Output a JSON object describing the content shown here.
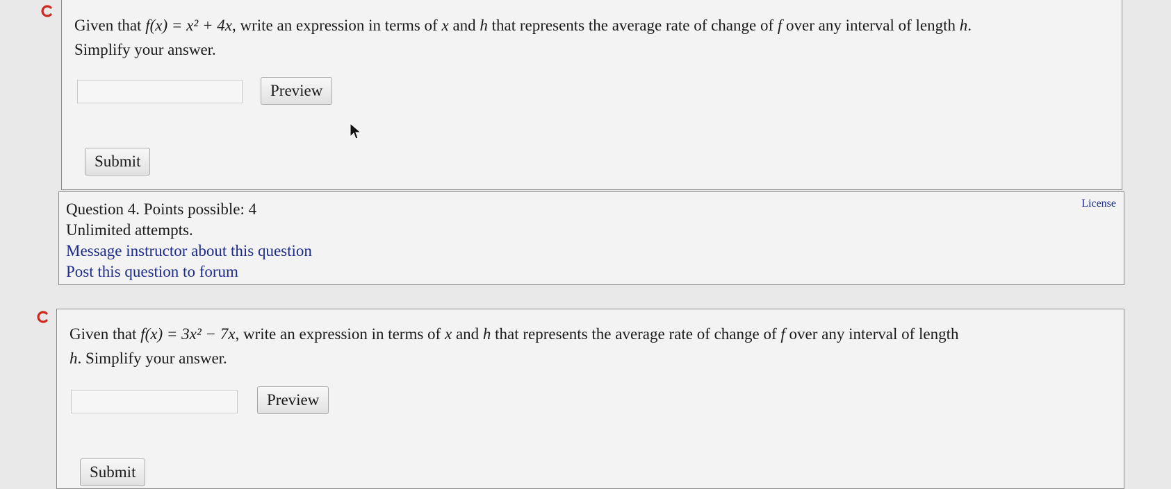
{
  "question1": {
    "line1_a": "Given that ",
    "line1_math": "f(x) = x² + 4x",
    "line1_b": ", write an expression in terms of ",
    "var_x": "x",
    "line1_c": " and ",
    "var_h": "h",
    "line1_d": " that represents the average rate of change of ",
    "var_f": "f",
    "line1_e": " over any interval of length ",
    "line1_end": ".",
    "line2": "Simplify your answer.",
    "answer_value": "",
    "preview_label": "Preview",
    "submit_label": "Submit"
  },
  "info": {
    "points": "Question 4. Points possible: 4",
    "attempts": "Unlimited attempts.",
    "message_link": "Message instructor about this question",
    "forum_link": "Post this question to forum",
    "license_link": "License"
  },
  "question2": {
    "line1_a": "Given that ",
    "line1_math": "f(x) = 3x² − 7x",
    "line1_b": ", write an expression in terms of ",
    "var_x": "x",
    "line1_c": " and ",
    "var_h": "h",
    "line1_d": " that represents the average rate of change of ",
    "var_f": "f",
    "line1_e": " over any interval of length",
    "line2_h": "h",
    "line2": ". Simplify your answer.",
    "answer_value": "",
    "preview_label": "Preview",
    "submit_label": "Submit"
  },
  "colors": {
    "refresh_icon": "#cc2a1f",
    "link": "#1d2c8c",
    "panel_bg": "#f3f3f3",
    "page_bg": "#e9e9e9"
  },
  "icons": [
    "refresh-icon",
    "mouse-pointer-icon"
  ]
}
